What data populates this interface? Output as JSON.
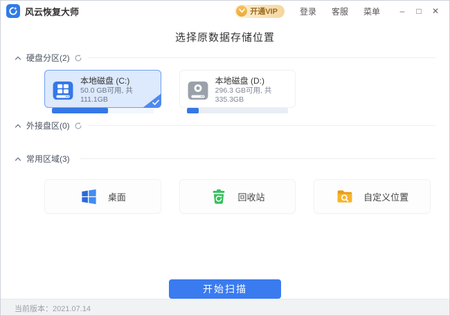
{
  "titlebar": {
    "app_title": "风云恢复大师",
    "vip_label": "开通VIP",
    "links": [
      "登录",
      "客服",
      "菜单"
    ],
    "controls": {
      "minimize": "–",
      "maximize": "□",
      "close": "✕"
    }
  },
  "page": {
    "heading": "选择原数据存储位置"
  },
  "sections": {
    "partitions": {
      "label": "硬盘分区(2)"
    },
    "external": {
      "label": "外接盘区(0)"
    },
    "common": {
      "label": "常用区域(3)"
    }
  },
  "disks": [
    {
      "name": "本地磁盘 (C:)",
      "info": "50.0 GB可用, 共111.1GB",
      "used_percent": 55,
      "selected": true
    },
    {
      "name": "本地磁盘 (D:)",
      "info": "296.3 GB可用, 共335.3GB",
      "used_percent": 12,
      "selected": false
    }
  ],
  "common_areas": [
    {
      "label": "桌面",
      "icon": "windows-logo-icon"
    },
    {
      "label": "回收站",
      "icon": "recycle-bin-icon"
    },
    {
      "label": "自定义位置",
      "icon": "folder-search-icon"
    }
  ],
  "actions": {
    "scan_label": "开始扫描"
  },
  "footer": {
    "version_text": "当前版本：2021.07.14"
  },
  "colors": {
    "primary_blue": "#3a7bf0",
    "progress_blue": "#3578e5",
    "selected_card_bg": "#dde9fc",
    "selected_card_border": "#6f9ef2",
    "disk_icon_gray": "#9ba1ab",
    "vip_text": "#99691f",
    "recycle_green": "#34c159",
    "folder_orange": "#f6b21e"
  }
}
